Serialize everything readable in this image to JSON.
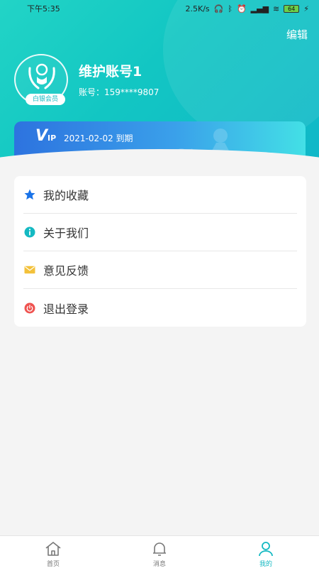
{
  "status_bar": {
    "time": "下午5:35",
    "network_speed": "2.5K/s",
    "battery": "64"
  },
  "header": {
    "edit_label": "编辑",
    "avatar_tag": "白银会员",
    "username": "维护账号1",
    "account": "账号：159****9807"
  },
  "vip": {
    "logo": "V",
    "logo_sub": "IP",
    "expiry": "2021-02-02 到期"
  },
  "menu": {
    "items": [
      {
        "label": "我的收藏",
        "icon": "star-icon",
        "color": "#1a73e8"
      },
      {
        "label": "关于我们",
        "icon": "info-icon",
        "color": "#14b9c2"
      },
      {
        "label": "意见反馈",
        "icon": "mail-icon",
        "color": "#f3c13a"
      },
      {
        "label": "退出登录",
        "icon": "power-icon",
        "color": "#ef5350"
      }
    ]
  },
  "tabbar": {
    "tabs": [
      {
        "label": "首页",
        "icon": "home-icon"
      },
      {
        "label": "消息",
        "icon": "bell-icon"
      },
      {
        "label": "我的",
        "icon": "user-icon"
      }
    ]
  },
  "colors": {
    "accent": "#14b9c2",
    "header_gradient_start": "#22d4c6",
    "vip_gradient_start": "#2d73df"
  }
}
